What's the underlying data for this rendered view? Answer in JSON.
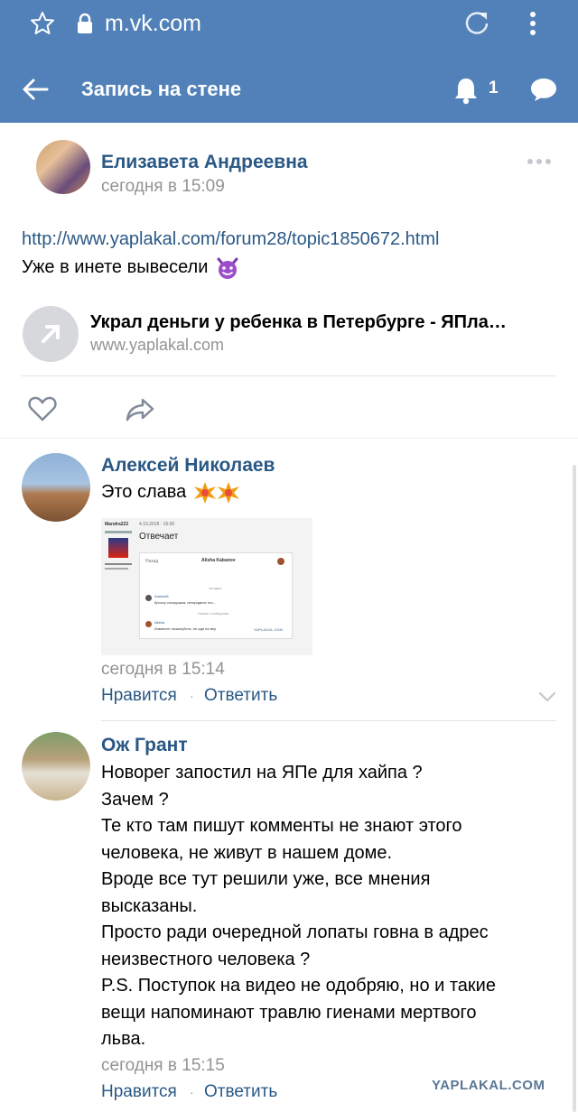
{
  "browser": {
    "url": "m.vk.com"
  },
  "header": {
    "title": "Запись на стене",
    "notif_count": "1"
  },
  "post": {
    "author": "Елизавета Андреевна",
    "time": "сегодня в 15:09",
    "link": "http://www.yaplakal.com/forum28/topic1850672.html",
    "text": "Уже в инете вывесели",
    "share": {
      "title": "Украл деньги у ребенка в Петербурге - ЯПла…",
      "domain": "www.yaplakal.com"
    }
  },
  "comments": [
    {
      "author": "Алексей Николаев",
      "text": "Это слава",
      "time": "сегодня в 15:14",
      "like": "Нравится",
      "reply": "Ответить",
      "screenshot": {
        "user": "Mandra222",
        "date": "4.10.2018 · 15:00",
        "heading": "Отвечает",
        "back": "Назад",
        "chat_name": "Alisha Kabanov",
        "day": "сегодня",
        "msg1_name": "Алексей",
        "msg1_text": "Кроссу соседошка, негорядное это...",
        "new_msgs": "Новые сообщения",
        "msg2_name": "Alisha",
        "msg2_text": "Извините пожалуйста, не иди на вер",
        "wm": "YAPLAKAL.COM"
      }
    },
    {
      "author": "Ож Грант",
      "lines": [
        "Новорег запостил на ЯПе для хайпа ?",
        "Зачем ?",
        "Те кто там пишут комменты не знают этого",
        "человека, не живут в нашем доме.",
        "Вроде все тут решили уже, все мнения",
        "высказаны.",
        "Просто ради очередной лопаты говна в адрес",
        "неизвестного человека ?",
        "P.S. Поступок на видео не одобряю, но и такие",
        "вещи напоминают травлю гиенами мертвого",
        "льва."
      ],
      "time": "сегодня в 15:15",
      "like": "Нравится",
      "reply": "Ответить"
    }
  ],
  "watermark": "YAPLAKAL.COM",
  "colors": {
    "header": "#5181b8",
    "link": "#2a5885",
    "muted": "#939393",
    "divider": "#e1e3e6"
  }
}
